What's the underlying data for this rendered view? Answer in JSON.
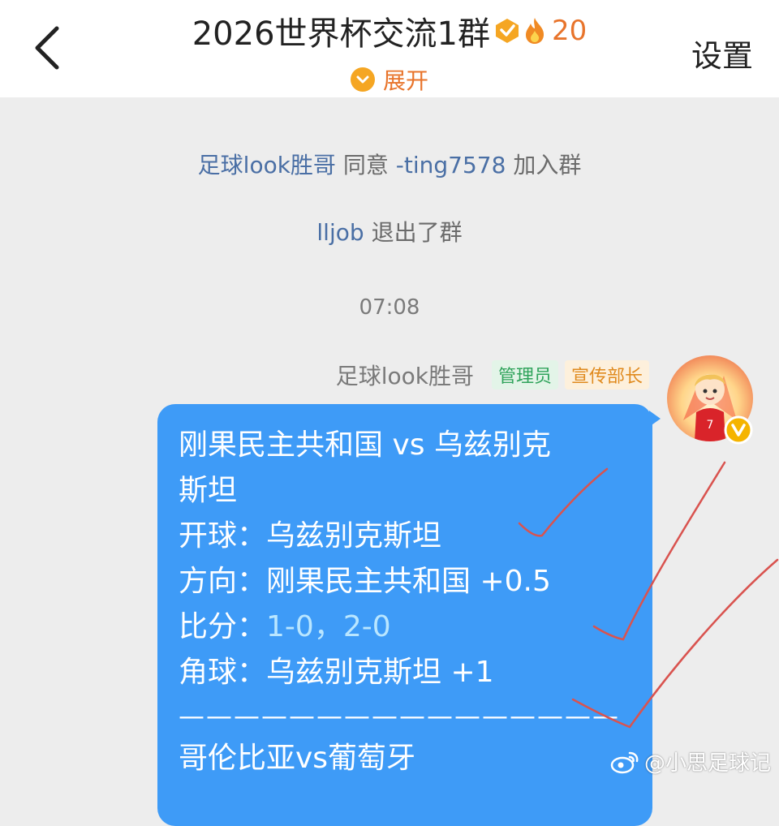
{
  "header": {
    "title": "2026世界杯交流1群",
    "heat": "20",
    "settings_label": "设置",
    "expand_label": "展开"
  },
  "system_messages": [
    {
      "name": "足球look胜哥",
      "text": "同意",
      "target": "-ting7578",
      "tail": "加入群"
    },
    {
      "name": "lljob",
      "text": "退出了群"
    }
  ],
  "timestamp": "07:08",
  "message": {
    "sender": "足球look胜哥",
    "tags": [
      "管理员",
      "宣传部长"
    ],
    "lines": [
      "刚果民主共和国 vs 乌兹别克",
      "斯坦",
      "开球：乌兹别克斯坦",
      "方向：刚果民主共和国 +0.5",
      "角球：乌兹别克斯坦 +1",
      "————————————————",
      "哥伦比亚vs葡萄牙"
    ],
    "score_label": "比分：",
    "score_value": "1-0，2-0"
  },
  "watermark": "@小思足球记",
  "colors": {
    "bubble": "#3e9bf7",
    "accent": "#e8742b",
    "admin_tag": "#2fa35b",
    "promo_tag": "#e08a1e",
    "annotation": "#d9534f"
  }
}
